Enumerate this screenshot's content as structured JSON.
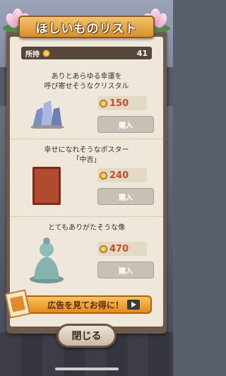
{
  "title": "ほしいものリスト",
  "owned": {
    "label": "所持",
    "value": "41"
  },
  "items": [
    {
      "desc": "ありとあらゆる幸運を\n呼び寄せそうなクリスタル",
      "price": "150",
      "buy_label": "購入",
      "icon": "crystal-icon"
    },
    {
      "desc": "幸せになれそうなポスター\n「中吉」",
      "price": "240",
      "buy_label": "購入",
      "icon": "poster-icon"
    },
    {
      "desc": "とてもありがたそうな像",
      "price": "470",
      "buy_label": "購入",
      "icon": "statue-icon"
    }
  ],
  "ad": {
    "label": "広告を見てお得に！"
  },
  "close": {
    "label": "閉じる"
  },
  "colors": {
    "price": "#c0502a",
    "banner": "#e48a1e",
    "panel": "#6e5a4a"
  }
}
